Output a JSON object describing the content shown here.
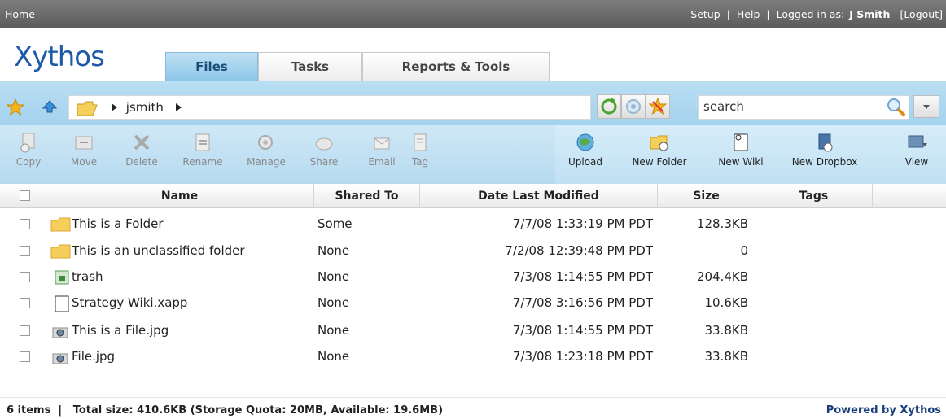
{
  "topbar": {
    "home": "Home",
    "setup": "Setup",
    "help": "Help",
    "logged_in_label": "Logged in as:",
    "user": "J Smith",
    "logout": "[Logout]",
    "separator": "|"
  },
  "logo": "Xythos",
  "tabs": [
    {
      "label": "Files",
      "active": true
    },
    {
      "label": "Tasks",
      "active": false
    },
    {
      "label": "Reports & Tools",
      "active": false
    }
  ],
  "path": {
    "crumb": "jsmith"
  },
  "search": {
    "placeholder": "search"
  },
  "toolbar": {
    "left": [
      "Copy",
      "Move",
      "Delete",
      "Rename",
      "Manage",
      "Share",
      "Email",
      "Tag"
    ],
    "right": [
      "Upload",
      "New Folder",
      "New Wiki",
      "New Dropbox",
      "View"
    ]
  },
  "table": {
    "columns": [
      "Name",
      "Shared To",
      "Date Last Modified",
      "Size",
      "Tags"
    ],
    "rows": [
      {
        "icon": "folder-icon",
        "name": "This is a Folder",
        "shared": "Some",
        "date": "7/7/08 1:33:19 PM PDT",
        "size": "128.3KB"
      },
      {
        "icon": "folder-icon",
        "name": "This is an unclassified folder",
        "shared": "None",
        "date": "7/2/08 12:39:48 PM PDT",
        "size": "0"
      },
      {
        "icon": "trash-icon",
        "name": "trash",
        "shared": "None",
        "date": "7/3/08 1:14:55 PM PDT",
        "size": "204.4KB"
      },
      {
        "icon": "wiki-page-icon",
        "name": "Strategy Wiki.xapp",
        "shared": "None",
        "date": "7/7/08 3:16:56 PM PDT",
        "size": "10.6KB"
      },
      {
        "icon": "image-file-icon",
        "name": "This is a File.jpg",
        "shared": "None",
        "date": "7/3/08 1:14:55 PM PDT",
        "size": "33.8KB"
      },
      {
        "icon": "image-file-icon",
        "name": "File.jpg",
        "shared": "None",
        "date": "7/3/08 1:23:18 PM PDT",
        "size": "33.8KB"
      }
    ]
  },
  "footer": {
    "summary": "6 items  |   Total size: 410.6KB (Storage Quota: 20MB, Available: 19.6MB)",
    "powered": "Powered by Xythos"
  },
  "colors": {
    "accent": "#a9d4ef",
    "active_tab": "#8cc6e8",
    "logo": "#1e5aa8"
  }
}
